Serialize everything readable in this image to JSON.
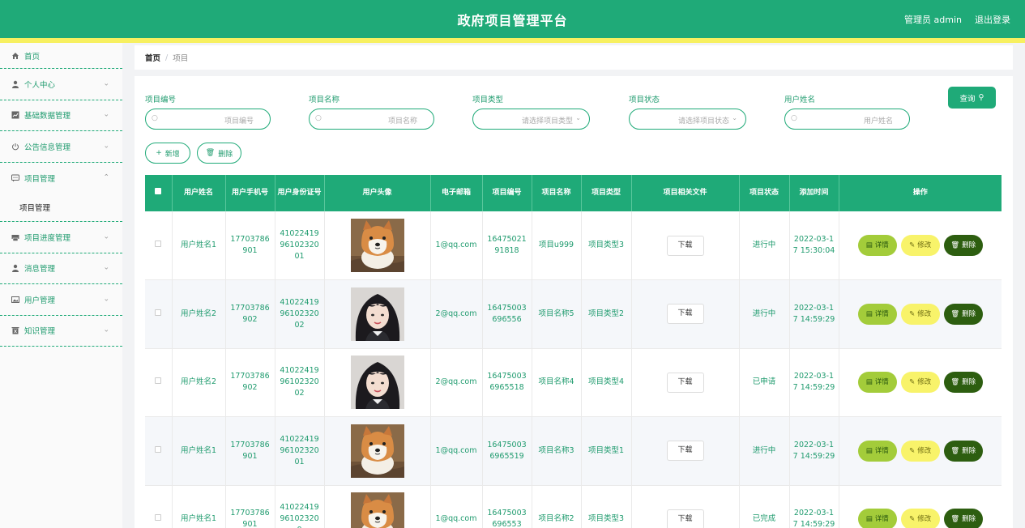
{
  "header": {
    "title": "政府项目管理平台",
    "admin_label": "管理员 admin",
    "logout_label": "退出登录"
  },
  "colors": {
    "primary": "#1faa78",
    "accent_strip": "#f7f060",
    "detail": "#a3cc3a",
    "edit": "#f8f36a",
    "delete": "#2d5e10"
  },
  "sidebar": {
    "items": [
      {
        "label": "首页",
        "icon": "home-icon"
      },
      {
        "label": "个人中心",
        "icon": "user-icon"
      },
      {
        "label": "基础数据管理",
        "icon": "chart-icon"
      },
      {
        "label": "公告信息管理",
        "icon": "power-icon"
      },
      {
        "label": "项目管理",
        "icon": "chat-icon",
        "sub": "项目管理"
      },
      {
        "label": "项目进度管理",
        "icon": "printer-icon"
      },
      {
        "label": "消息管理",
        "icon": "user-icon"
      },
      {
        "label": "用户管理",
        "icon": "picture-icon"
      },
      {
        "label": "知识管理",
        "icon": "delete-icon"
      }
    ]
  },
  "breadcrumb": {
    "home": "首页",
    "separator": "/",
    "current": "项目"
  },
  "search": {
    "fields": [
      {
        "label": "项目编号",
        "placeholder": "项目编号"
      },
      {
        "label": "项目名称",
        "placeholder": "项目名称"
      },
      {
        "label": "项目类型",
        "placeholder": "请选择项目类型"
      },
      {
        "label": "项目状态",
        "placeholder": "请选择项目状态"
      },
      {
        "label": "用户姓名",
        "placeholder": "用户姓名"
      }
    ],
    "query_label": "查询"
  },
  "actions": {
    "add_label": "新增",
    "delete_label": "删除"
  },
  "table": {
    "columns": [
      "用户姓名",
      "用户手机号",
      "用户身份证号",
      "用户头像",
      "电子邮箱",
      "项目编号",
      "项目名称",
      "项目类型",
      "项目相关文件",
      "项目状态",
      "添加时间",
      "操作"
    ],
    "download_label": "下载",
    "detail_label": "详情",
    "edit_label": "修改",
    "delete_label": "删除",
    "rows": [
      {
        "name": "用户姓名1",
        "phone": "17703786901",
        "idcard": "410224199610232001",
        "avatar": "dog",
        "email": "1@qq.com",
        "code": "1647502191818",
        "pname": "项目u999",
        "ptype": "项目类型3",
        "status": "进行中",
        "time": "2022-03-17 15:30:04"
      },
      {
        "name": "用户姓名2",
        "phone": "17703786902",
        "idcard": "410224199610232002",
        "avatar": "girl",
        "email": "2@qq.com",
        "code": "16475003696556",
        "pname": "项目名称5",
        "ptype": "项目类型2",
        "status": "进行中",
        "time": "2022-03-17 14:59:29"
      },
      {
        "name": "用户姓名2",
        "phone": "17703786902",
        "idcard": "410224199610232002",
        "avatar": "girl",
        "email": "2@qq.com",
        "code": "164750036965518",
        "pname": "项目名称4",
        "ptype": "项目类型4",
        "status": "已申请",
        "time": "2022-03-17 14:59:29"
      },
      {
        "name": "用户姓名1",
        "phone": "17703786901",
        "idcard": "410224199610232001",
        "avatar": "dog",
        "email": "1@qq.com",
        "code": "164750036965519",
        "pname": "项目名称3",
        "ptype": "项目类型1",
        "status": "进行中",
        "time": "2022-03-17 14:59:29"
      },
      {
        "name": "用户姓名1",
        "phone": "17703786901",
        "idcard": "41022419961023200",
        "avatar": "dog",
        "email": "1@qq.com",
        "code": "16475003696553",
        "pname": "项目名称2",
        "ptype": "项目类型3",
        "status": "已完成",
        "time": "2022-03-17 14:59:29"
      }
    ]
  }
}
